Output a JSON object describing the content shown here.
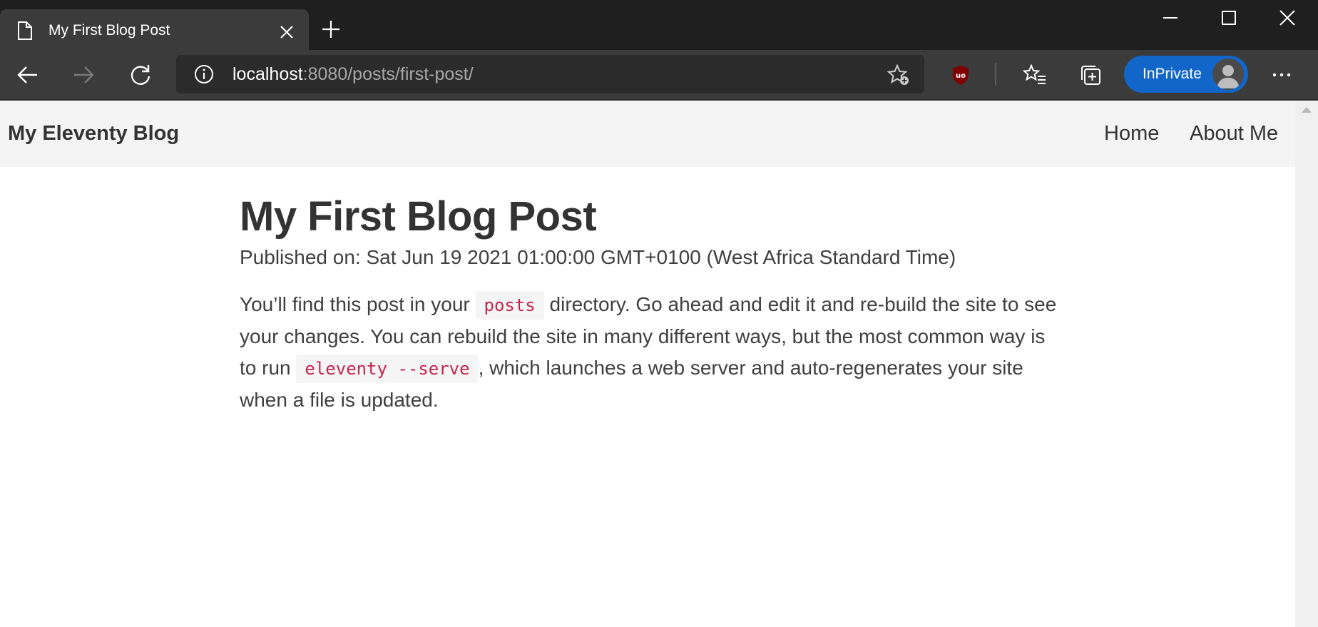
{
  "browser": {
    "tab": {
      "title": "My First Blog Post",
      "icon": "page-icon"
    },
    "address": {
      "host": "localhost",
      "rest": ":8080/posts/first-post/"
    },
    "inprivate_label": "InPrivate",
    "icons": [
      "back-icon",
      "forward-icon",
      "refresh-icon",
      "info-icon",
      "add-favorite-icon",
      "ublock-icon",
      "favorites-icon",
      "collections-icon",
      "more-icon",
      "minimize-icon",
      "maximize-icon",
      "close-icon",
      "new-tab-icon"
    ]
  },
  "site": {
    "title": "My Eleventy Blog",
    "nav": {
      "home": "Home",
      "about": "About Me"
    }
  },
  "post": {
    "title": "My First Blog Post",
    "published": "Published on: Sat Jun 19 2021 01:00:00 GMT+0100 (West Africa Standard Time)",
    "body": {
      "t1": "You’ll find this post in your ",
      "code1": "posts",
      "t2": " directory. Go ahead and edit it and re-build the site to see your changes. You can rebuild the site in many different ways, but the most common way is to run ",
      "code2": "eleventy --serve",
      "t3": ", which launches a web server and auto-regenerates your site when a file is updated."
    }
  },
  "colors": {
    "chrome_dark": "#1f1f1f",
    "chrome_toolbar": "#3b3b3b",
    "inprivate_blue": "#1266c9",
    "header_bg": "#f4f4f4",
    "code_red": "#c7254e"
  }
}
